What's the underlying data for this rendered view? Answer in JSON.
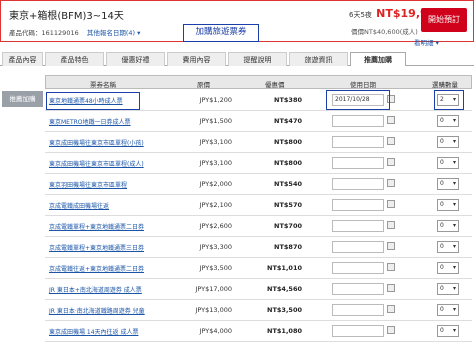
{
  "header": {
    "title": "東京+箱根(BFM)3~14天",
    "code_label": "產品代碼：161129016",
    "other_dates": "其他報名日期(4) ▾",
    "days": "6天5夜",
    "price": "NT$19,920",
    "per": "/人",
    "deposit": "價價NT$40,600(成人)",
    "view_more": "看明細 ▾",
    "book": "開始預訂"
  },
  "banner": "加購旅遊票券",
  "tabs": [
    "產品內容",
    "產品特色",
    "優惠好禮",
    "費用內容",
    "提醒說明",
    "旅遊資訊",
    "推薦加購"
  ],
  "side_label": "推薦加購",
  "table": {
    "headers": [
      "票券名稱",
      "原價",
      "優惠價",
      "使用日期",
      "選購數量"
    ],
    "rows": [
      {
        "name": "東京地鐵通票48小時成人票",
        "jpy": "JPY$1,200",
        "ntd": "NT$380",
        "date": "2017/10/28",
        "qty": "2"
      },
      {
        "name": "東京METRO地鐵一日券成人票",
        "jpy": "JPY$1,500",
        "ntd": "NT$470",
        "date": "",
        "qty": "0"
      },
      {
        "name": "東京成田機場往東京市區單程(小孩)",
        "jpy": "JPY$3,100",
        "ntd": "NT$800",
        "date": "",
        "qty": "0"
      },
      {
        "name": "東京成田機場往東京市區單程(成人)",
        "jpy": "JPY$3,100",
        "ntd": "NT$800",
        "date": "",
        "qty": "0"
      },
      {
        "name": "東京羽田機場往東京市區單程",
        "jpy": "JPY$2,000",
        "ntd": "NT$540",
        "date": "",
        "qty": "0"
      },
      {
        "name": "京成電鐵成田機場往返",
        "jpy": "JPY$2,100",
        "ntd": "NT$570",
        "date": "",
        "qty": "0"
      },
      {
        "name": "京成電鐵單程+東京地鐵通票二日券",
        "jpy": "JPY$2,600",
        "ntd": "NT$700",
        "date": "",
        "qty": "0"
      },
      {
        "name": "京成電鐵單程+東京地鐵通票三日券",
        "jpy": "JPY$3,300",
        "ntd": "NT$870",
        "date": "",
        "qty": "0"
      },
      {
        "name": "京成電鐵往返+東京地鐵通票二日券",
        "jpy": "JPY$3,500",
        "ntd": "NT$1,010",
        "date": "",
        "qty": "0"
      },
      {
        "name": "JR 東日本+南北海道周遊券 成人票",
        "jpy": "JPY$17,000",
        "ntd": "NT$4,560",
        "date": "",
        "qty": "0"
      },
      {
        "name": "JR 東日本·南北海道鐵路周遊券 兒童",
        "jpy": "JPY$13,000",
        "ntd": "NT$3,500",
        "date": "",
        "qty": "0"
      },
      {
        "name": "東京成田機場 14天內往返 成人票",
        "jpy": "JPY$4,000",
        "ntd": "NT$1,080",
        "date": "",
        "qty": "0"
      }
    ]
  },
  "colors": {
    "accent_red": "#d0021b",
    "highlight_blue": "#1a3fa8"
  }
}
